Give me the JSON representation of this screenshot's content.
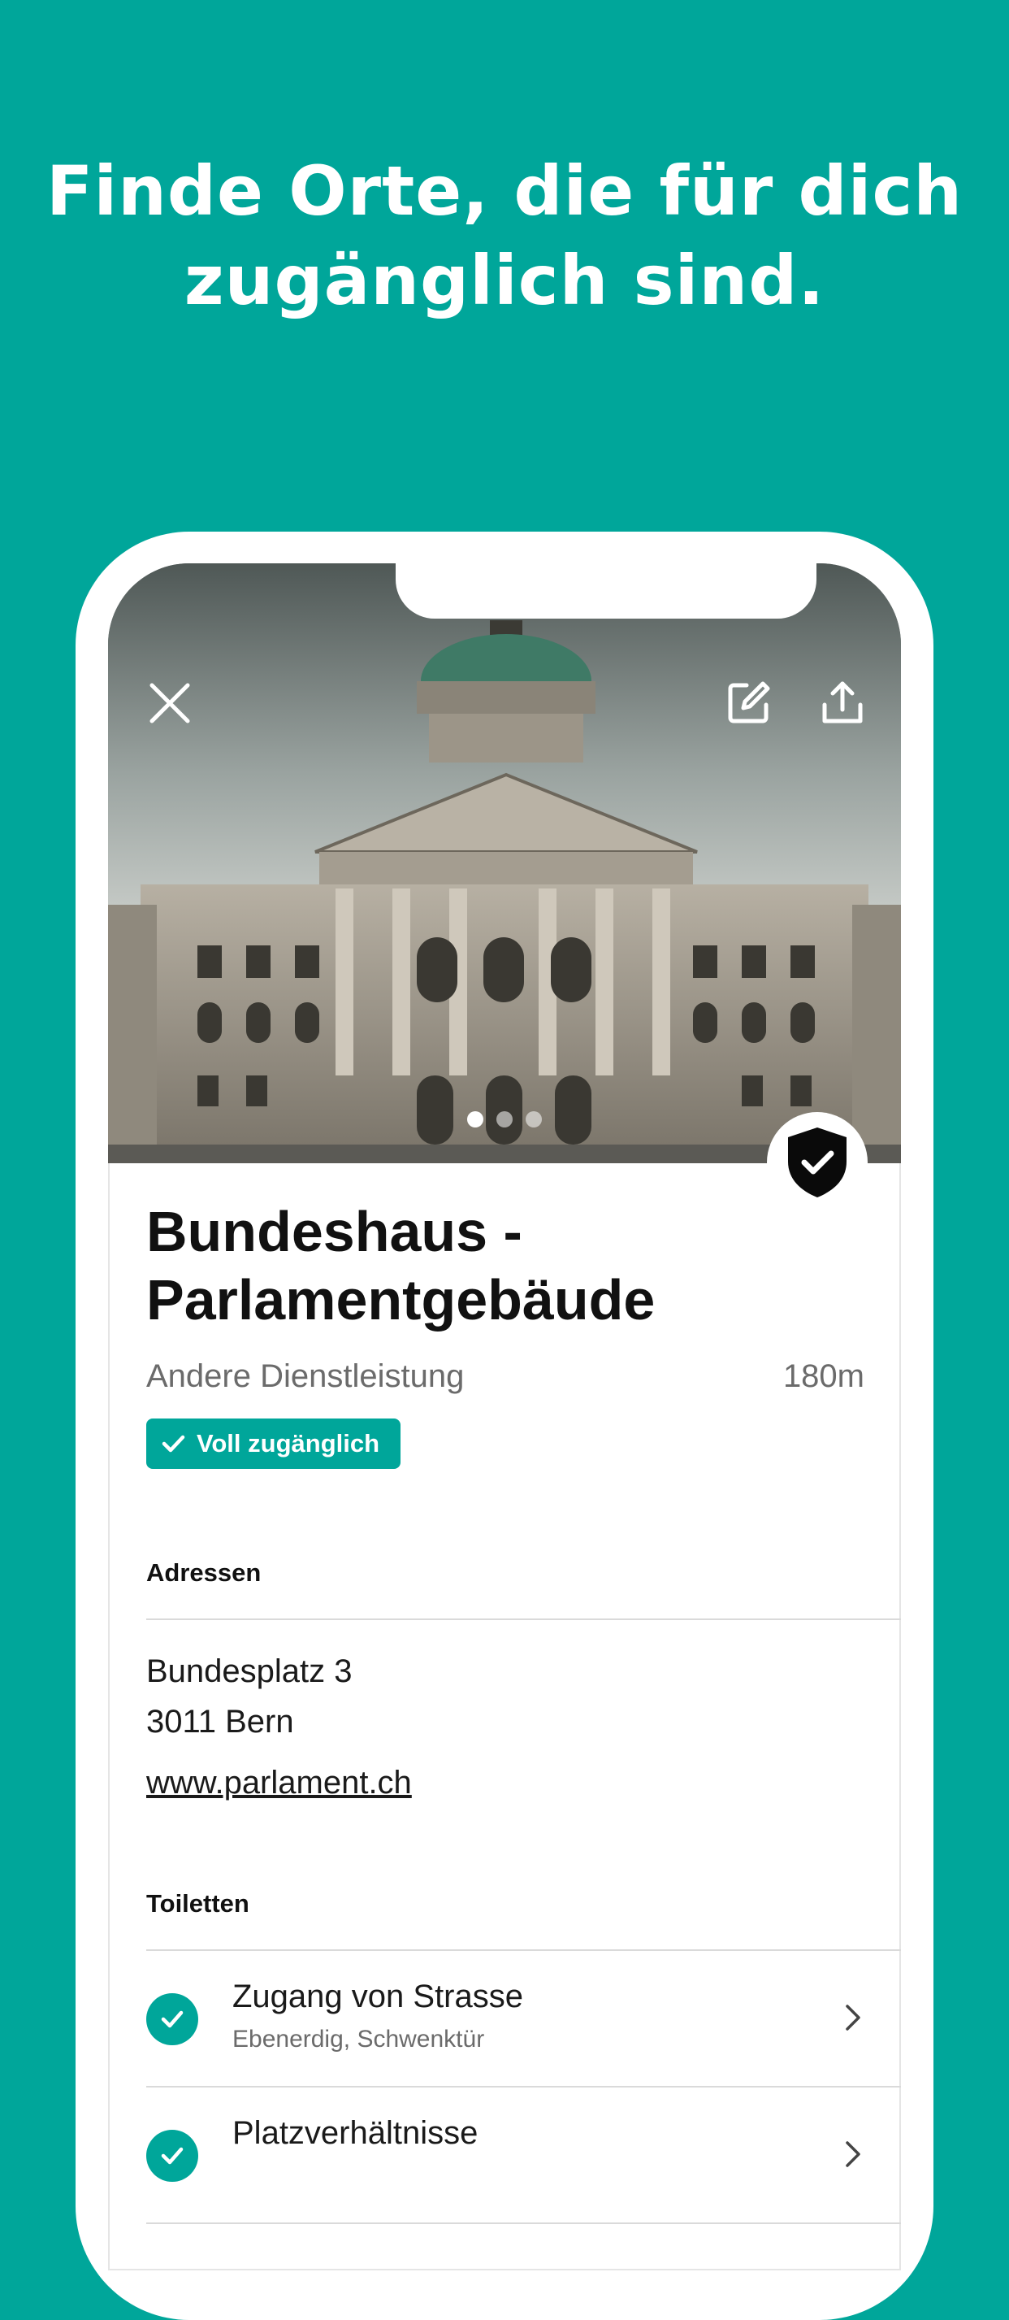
{
  "headline": {
    "line1": "Finde Orte, die für dich",
    "line2": "zugänglich sind."
  },
  "colors": {
    "accent": "#00A69A",
    "text_dark": "#111111",
    "text_muted": "#6b6b6b"
  },
  "hero": {
    "image_pages": 3,
    "active_page": 1,
    "icons": [
      "close-icon",
      "edit-icon",
      "share-icon"
    ],
    "badge_icon": "shield-check-icon"
  },
  "place": {
    "title_line1": "Bundeshaus -",
    "title_line2": "Parlamentgebäude",
    "category": "Andere Dienstleistung",
    "distance": "180m",
    "access_label": "Voll zugänglich"
  },
  "address_section": {
    "label": "Adressen",
    "street": "Bundesplatz 3",
    "city": "3011 Bern",
    "website": "www.parlament.ch"
  },
  "toilets_section": {
    "label": "Toiletten",
    "items": [
      {
        "title": "Zugang von Strasse",
        "subtitle": "Ebenerdig, Schwenktür"
      },
      {
        "title": "Platzverhältnisse",
        "subtitle": ""
      }
    ]
  }
}
